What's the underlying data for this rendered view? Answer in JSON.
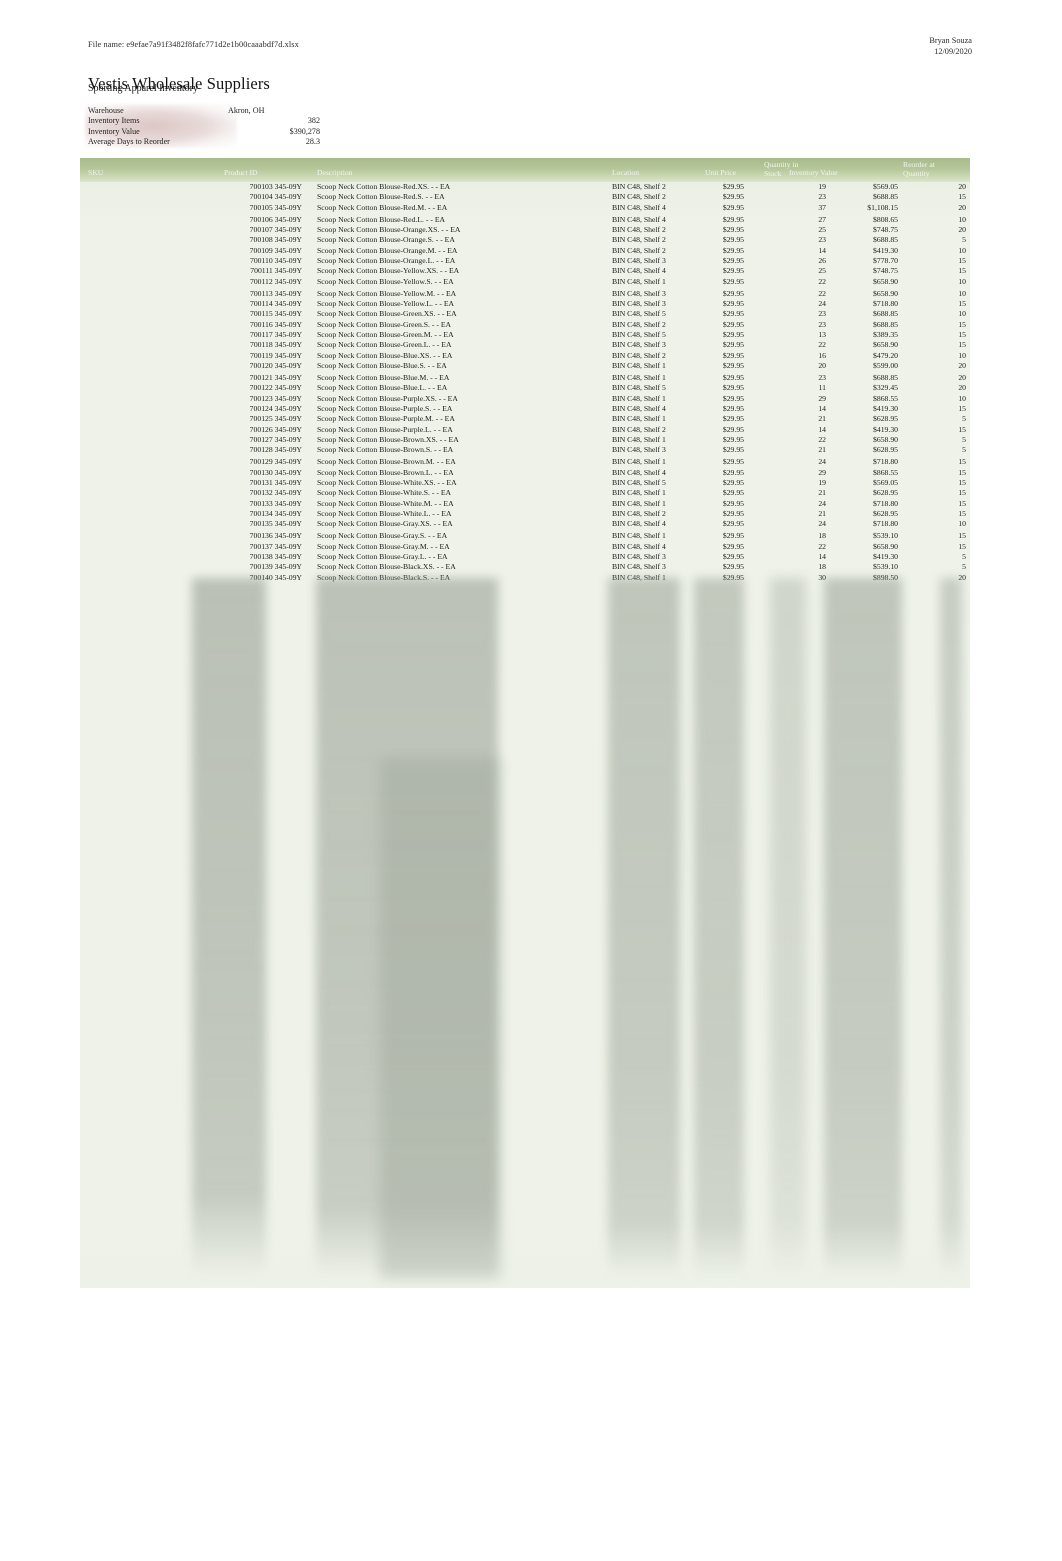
{
  "meta": {
    "file_name_label": "File name: e9efae7a91f3482f8fafc771d2e1b00caaabdf7d.xlsx",
    "author": "Bryan Souza",
    "date": "12/09/2020"
  },
  "header": {
    "company": "Vestis Wholesale Suppliers",
    "report_title": "Sporting Apparel Inventory"
  },
  "summary": {
    "rows": [
      {
        "label": "Warehouse",
        "value": "Akron, OH",
        "align": "left"
      },
      {
        "label": "Inventory Items",
        "value": "382",
        "align": "right"
      },
      {
        "label": "Inventory Value",
        "value": "$390,278",
        "align": "right"
      },
      {
        "label": "Average Days to Reorder",
        "value": "28.3",
        "align": "right"
      }
    ]
  },
  "table": {
    "columns": {
      "sku": "SKU",
      "product_id": "Product ID",
      "description": "Description",
      "location": "Location",
      "unit_price": "Unit Price",
      "quantity_in_stock_line1": "Quantity in",
      "quantity_in_stock_line2": "Stock",
      "inventory_value": "Inventory Value",
      "reorder_at_line1": "Reorder at",
      "reorder_at_line2": "Quantity"
    },
    "rows": [
      {
        "sku": "",
        "product_id": "700103 345-09Y",
        "description": "Scoop Neck Cotton Blouse-Red.XS. - - EA",
        "location": "BIN C48, Shelf 2",
        "unit_price": "$29.95",
        "qty": "19",
        "value": "$569.05",
        "reorder": "20",
        "group_start": false
      },
      {
        "sku": "",
        "product_id": "700104 345-09Y",
        "description": "Scoop Neck Cotton Blouse-Red.S. - - EA",
        "location": "BIN C48, Shelf 2",
        "unit_price": "$29.95",
        "qty": "23",
        "value": "$688.85",
        "reorder": "15",
        "group_start": false
      },
      {
        "sku": "",
        "product_id": "700105 345-09Y",
        "description": "Scoop Neck Cotton Blouse-Red.M. - - EA",
        "location": "BIN C48, Shelf 4",
        "unit_price": "$29.95",
        "qty": "37",
        "value": "$1,108.15",
        "reorder": "20",
        "group_start": false
      },
      {
        "sku": "",
        "product_id": "700106 345-09Y",
        "description": "Scoop Neck Cotton Blouse-Red.L. - - EA",
        "location": "BIN C48, Shelf 4",
        "unit_price": "$29.95",
        "qty": "27",
        "value": "$808.65",
        "reorder": "10",
        "group_start": true
      },
      {
        "sku": "",
        "product_id": "700107 345-09Y",
        "description": "Scoop Neck Cotton Blouse-Orange.XS. - - EA",
        "location": "BIN C48, Shelf 2",
        "unit_price": "$29.95",
        "qty": "25",
        "value": "$748.75",
        "reorder": "20",
        "group_start": false
      },
      {
        "sku": "",
        "product_id": "700108 345-09Y",
        "description": "Scoop Neck Cotton Blouse-Orange.S. - - EA",
        "location": "BIN C48, Shelf 2",
        "unit_price": "$29.95",
        "qty": "23",
        "value": "$688.85",
        "reorder": "5",
        "group_start": false
      },
      {
        "sku": "",
        "product_id": "700109 345-09Y",
        "description": "Scoop Neck Cotton Blouse-Orange.M. - - EA",
        "location": "BIN C48, Shelf 2",
        "unit_price": "$29.95",
        "qty": "14",
        "value": "$419.30",
        "reorder": "10",
        "group_start": false
      },
      {
        "sku": "",
        "product_id": "700110 345-09Y",
        "description": "Scoop Neck Cotton Blouse-Orange.L. - - EA",
        "location": "BIN C48, Shelf 3",
        "unit_price": "$29.95",
        "qty": "26",
        "value": "$778.70",
        "reorder": "15",
        "group_start": false
      },
      {
        "sku": "",
        "product_id": "700111 345-09Y",
        "description": "Scoop Neck Cotton Blouse-Yellow.XS. - - EA",
        "location": "BIN C48, Shelf 4",
        "unit_price": "$29.95",
        "qty": "25",
        "value": "$748.75",
        "reorder": "15",
        "group_start": false
      },
      {
        "sku": "",
        "product_id": "700112 345-09Y",
        "description": "Scoop Neck Cotton Blouse-Yellow.S. - - EA",
        "location": "BIN C48, Shelf 1",
        "unit_price": "$29.95",
        "qty": "22",
        "value": "$658.90",
        "reorder": "10",
        "group_start": false
      },
      {
        "sku": "",
        "product_id": "700113 345-09Y",
        "description": "Scoop Neck Cotton Blouse-Yellow.M. - - EA",
        "location": "BIN C48, Shelf 3",
        "unit_price": "$29.95",
        "qty": "22",
        "value": "$658.90",
        "reorder": "10",
        "group_start": true
      },
      {
        "sku": "",
        "product_id": "700114 345-09Y",
        "description": "Scoop Neck Cotton Blouse-Yellow.L. - - EA",
        "location": "BIN C48, Shelf 3",
        "unit_price": "$29.95",
        "qty": "24",
        "value": "$718.80",
        "reorder": "15",
        "group_start": false
      },
      {
        "sku": "",
        "product_id": "700115 345-09Y",
        "description": "Scoop Neck Cotton Blouse-Green.XS. - - EA",
        "location": "BIN C48, Shelf 5",
        "unit_price": "$29.95",
        "qty": "23",
        "value": "$688.85",
        "reorder": "10",
        "group_start": false
      },
      {
        "sku": "",
        "product_id": "700116 345-09Y",
        "description": "Scoop Neck Cotton Blouse-Green.S. - - EA",
        "location": "BIN C48, Shelf 2",
        "unit_price": "$29.95",
        "qty": "23",
        "value": "$688.85",
        "reorder": "15",
        "group_start": false
      },
      {
        "sku": "",
        "product_id": "700117 345-09Y",
        "description": "Scoop Neck Cotton Blouse-Green.M. - - EA",
        "location": "BIN C48, Shelf 5",
        "unit_price": "$29.95",
        "qty": "13",
        "value": "$389.35",
        "reorder": "15",
        "group_start": false
      },
      {
        "sku": "",
        "product_id": "700118 345-09Y",
        "description": "Scoop Neck Cotton Blouse-Green.L. - - EA",
        "location": "BIN C48, Shelf 3",
        "unit_price": "$29.95",
        "qty": "22",
        "value": "$658.90",
        "reorder": "15",
        "group_start": false
      },
      {
        "sku": "",
        "product_id": "700119 345-09Y",
        "description": "Scoop Neck Cotton Blouse-Blue.XS. - - EA",
        "location": "BIN C48, Shelf 2",
        "unit_price": "$29.95",
        "qty": "16",
        "value": "$479.20",
        "reorder": "10",
        "group_start": false
      },
      {
        "sku": "",
        "product_id": "700120 345-09Y",
        "description": "Scoop Neck Cotton Blouse-Blue.S. - - EA",
        "location": "BIN C48, Shelf 1",
        "unit_price": "$29.95",
        "qty": "20",
        "value": "$599.00",
        "reorder": "20",
        "group_start": false
      },
      {
        "sku": "",
        "product_id": "700121 345-09Y",
        "description": "Scoop Neck Cotton Blouse-Blue.M. - - EA",
        "location": "BIN C48, Shelf 1",
        "unit_price": "$29.95",
        "qty": "23",
        "value": "$688.85",
        "reorder": "20",
        "group_start": true
      },
      {
        "sku": "",
        "product_id": "700122 345-09Y",
        "description": "Scoop Neck Cotton Blouse-Blue.L. - - EA",
        "location": "BIN C48, Shelf 5",
        "unit_price": "$29.95",
        "qty": "11",
        "value": "$329.45",
        "reorder": "20",
        "group_start": false
      },
      {
        "sku": "",
        "product_id": "700123 345-09Y",
        "description": "Scoop Neck Cotton Blouse-Purple.XS. - - EA",
        "location": "BIN C48, Shelf 1",
        "unit_price": "$29.95",
        "qty": "29",
        "value": "$868.55",
        "reorder": "10",
        "group_start": false
      },
      {
        "sku": "",
        "product_id": "700124 345-09Y",
        "description": "Scoop Neck Cotton Blouse-Purple.S. - - EA",
        "location": "BIN C48, Shelf 4",
        "unit_price": "$29.95",
        "qty": "14",
        "value": "$419.30",
        "reorder": "15",
        "group_start": false
      },
      {
        "sku": "",
        "product_id": "700125 345-09Y",
        "description": "Scoop Neck Cotton Blouse-Purple.M. - - EA",
        "location": "BIN C48, Shelf 1",
        "unit_price": "$29.95",
        "qty": "21",
        "value": "$628.95",
        "reorder": "5",
        "group_start": false
      },
      {
        "sku": "",
        "product_id": "700126 345-09Y",
        "description": "Scoop Neck Cotton Blouse-Purple.L. - - EA",
        "location": "BIN C48, Shelf 2",
        "unit_price": "$29.95",
        "qty": "14",
        "value": "$419.30",
        "reorder": "15",
        "group_start": false
      },
      {
        "sku": "",
        "product_id": "700127 345-09Y",
        "description": "Scoop Neck Cotton Blouse-Brown.XS. - - EA",
        "location": "BIN C48, Shelf 1",
        "unit_price": "$29.95",
        "qty": "22",
        "value": "$658.90",
        "reorder": "5",
        "group_start": false
      },
      {
        "sku": "",
        "product_id": "700128 345-09Y",
        "description": "Scoop Neck Cotton Blouse-Brown.S. - - EA",
        "location": "BIN C48, Shelf 3",
        "unit_price": "$29.95",
        "qty": "21",
        "value": "$628.95",
        "reorder": "5",
        "group_start": false
      },
      {
        "sku": "",
        "product_id": "700129 345-09Y",
        "description": "Scoop Neck Cotton Blouse-Brown.M. - - EA",
        "location": "BIN C48, Shelf 1",
        "unit_price": "$29.95",
        "qty": "24",
        "value": "$718.80",
        "reorder": "15",
        "group_start": true
      },
      {
        "sku": "",
        "product_id": "700130 345-09Y",
        "description": "Scoop Neck Cotton Blouse-Brown.L. - - EA",
        "location": "BIN C48, Shelf 4",
        "unit_price": "$29.95",
        "qty": "29",
        "value": "$868.55",
        "reorder": "15",
        "group_start": false
      },
      {
        "sku": "",
        "product_id": "700131 345-09Y",
        "description": "Scoop Neck Cotton Blouse-White.XS. - - EA",
        "location": "BIN C48, Shelf 5",
        "unit_price": "$29.95",
        "qty": "19",
        "value": "$569.05",
        "reorder": "15",
        "group_start": false
      },
      {
        "sku": "",
        "product_id": "700132 345-09Y",
        "description": "Scoop Neck Cotton Blouse-White.S. - - EA",
        "location": "BIN C48, Shelf 1",
        "unit_price": "$29.95",
        "qty": "21",
        "value": "$628.95",
        "reorder": "15",
        "group_start": false
      },
      {
        "sku": "",
        "product_id": "700133 345-09Y",
        "description": "Scoop Neck Cotton Blouse-White.M. - - EA",
        "location": "BIN C48, Shelf 1",
        "unit_price": "$29.95",
        "qty": "24",
        "value": "$718.80",
        "reorder": "15",
        "group_start": false
      },
      {
        "sku": "",
        "product_id": "700134 345-09Y",
        "description": "Scoop Neck Cotton Blouse-White.L. - - EA",
        "location": "BIN C48, Shelf 2",
        "unit_price": "$29.95",
        "qty": "21",
        "value": "$628.95",
        "reorder": "15",
        "group_start": false
      },
      {
        "sku": "",
        "product_id": "700135 345-09Y",
        "description": "Scoop Neck Cotton Blouse-Gray.XS. - - EA",
        "location": "BIN C48, Shelf 4",
        "unit_price": "$29.95",
        "qty": "24",
        "value": "$718.80",
        "reorder": "10",
        "group_start": false
      },
      {
        "sku": "",
        "product_id": "700136 345-09Y",
        "description": "Scoop Neck Cotton Blouse-Gray.S. - - EA",
        "location": "BIN C48, Shelf 1",
        "unit_price": "$29.95",
        "qty": "18",
        "value": "$539.10",
        "reorder": "15",
        "group_start": true
      },
      {
        "sku": "",
        "product_id": "700137 345-09Y",
        "description": "Scoop Neck Cotton Blouse-Gray.M. - - EA",
        "location": "BIN C48, Shelf 4",
        "unit_price": "$29.95",
        "qty": "22",
        "value": "$658.90",
        "reorder": "15",
        "group_start": false
      },
      {
        "sku": "",
        "product_id": "700138 345-09Y",
        "description": "Scoop Neck Cotton Blouse-Gray.L. - - EA",
        "location": "BIN C48, Shelf 3",
        "unit_price": "$29.95",
        "qty": "14",
        "value": "$419.30",
        "reorder": "5",
        "group_start": false
      },
      {
        "sku": "",
        "product_id": "700139 345-09Y",
        "description": "Scoop Neck Cotton Blouse-Black.XS. - - EA",
        "location": "BIN C48, Shelf 3",
        "unit_price": "$29.95",
        "qty": "18",
        "value": "$539.10",
        "reorder": "5",
        "group_start": false
      },
      {
        "sku": "",
        "product_id": "700140 345-09Y",
        "description": "Scoop Neck Cotton Blouse-Black.S. - - EA",
        "location": "BIN C48, Shelf 1",
        "unit_price": "$29.95",
        "qty": "30",
        "value": "$898.50",
        "reorder": "20",
        "group_start": false
      }
    ]
  }
}
